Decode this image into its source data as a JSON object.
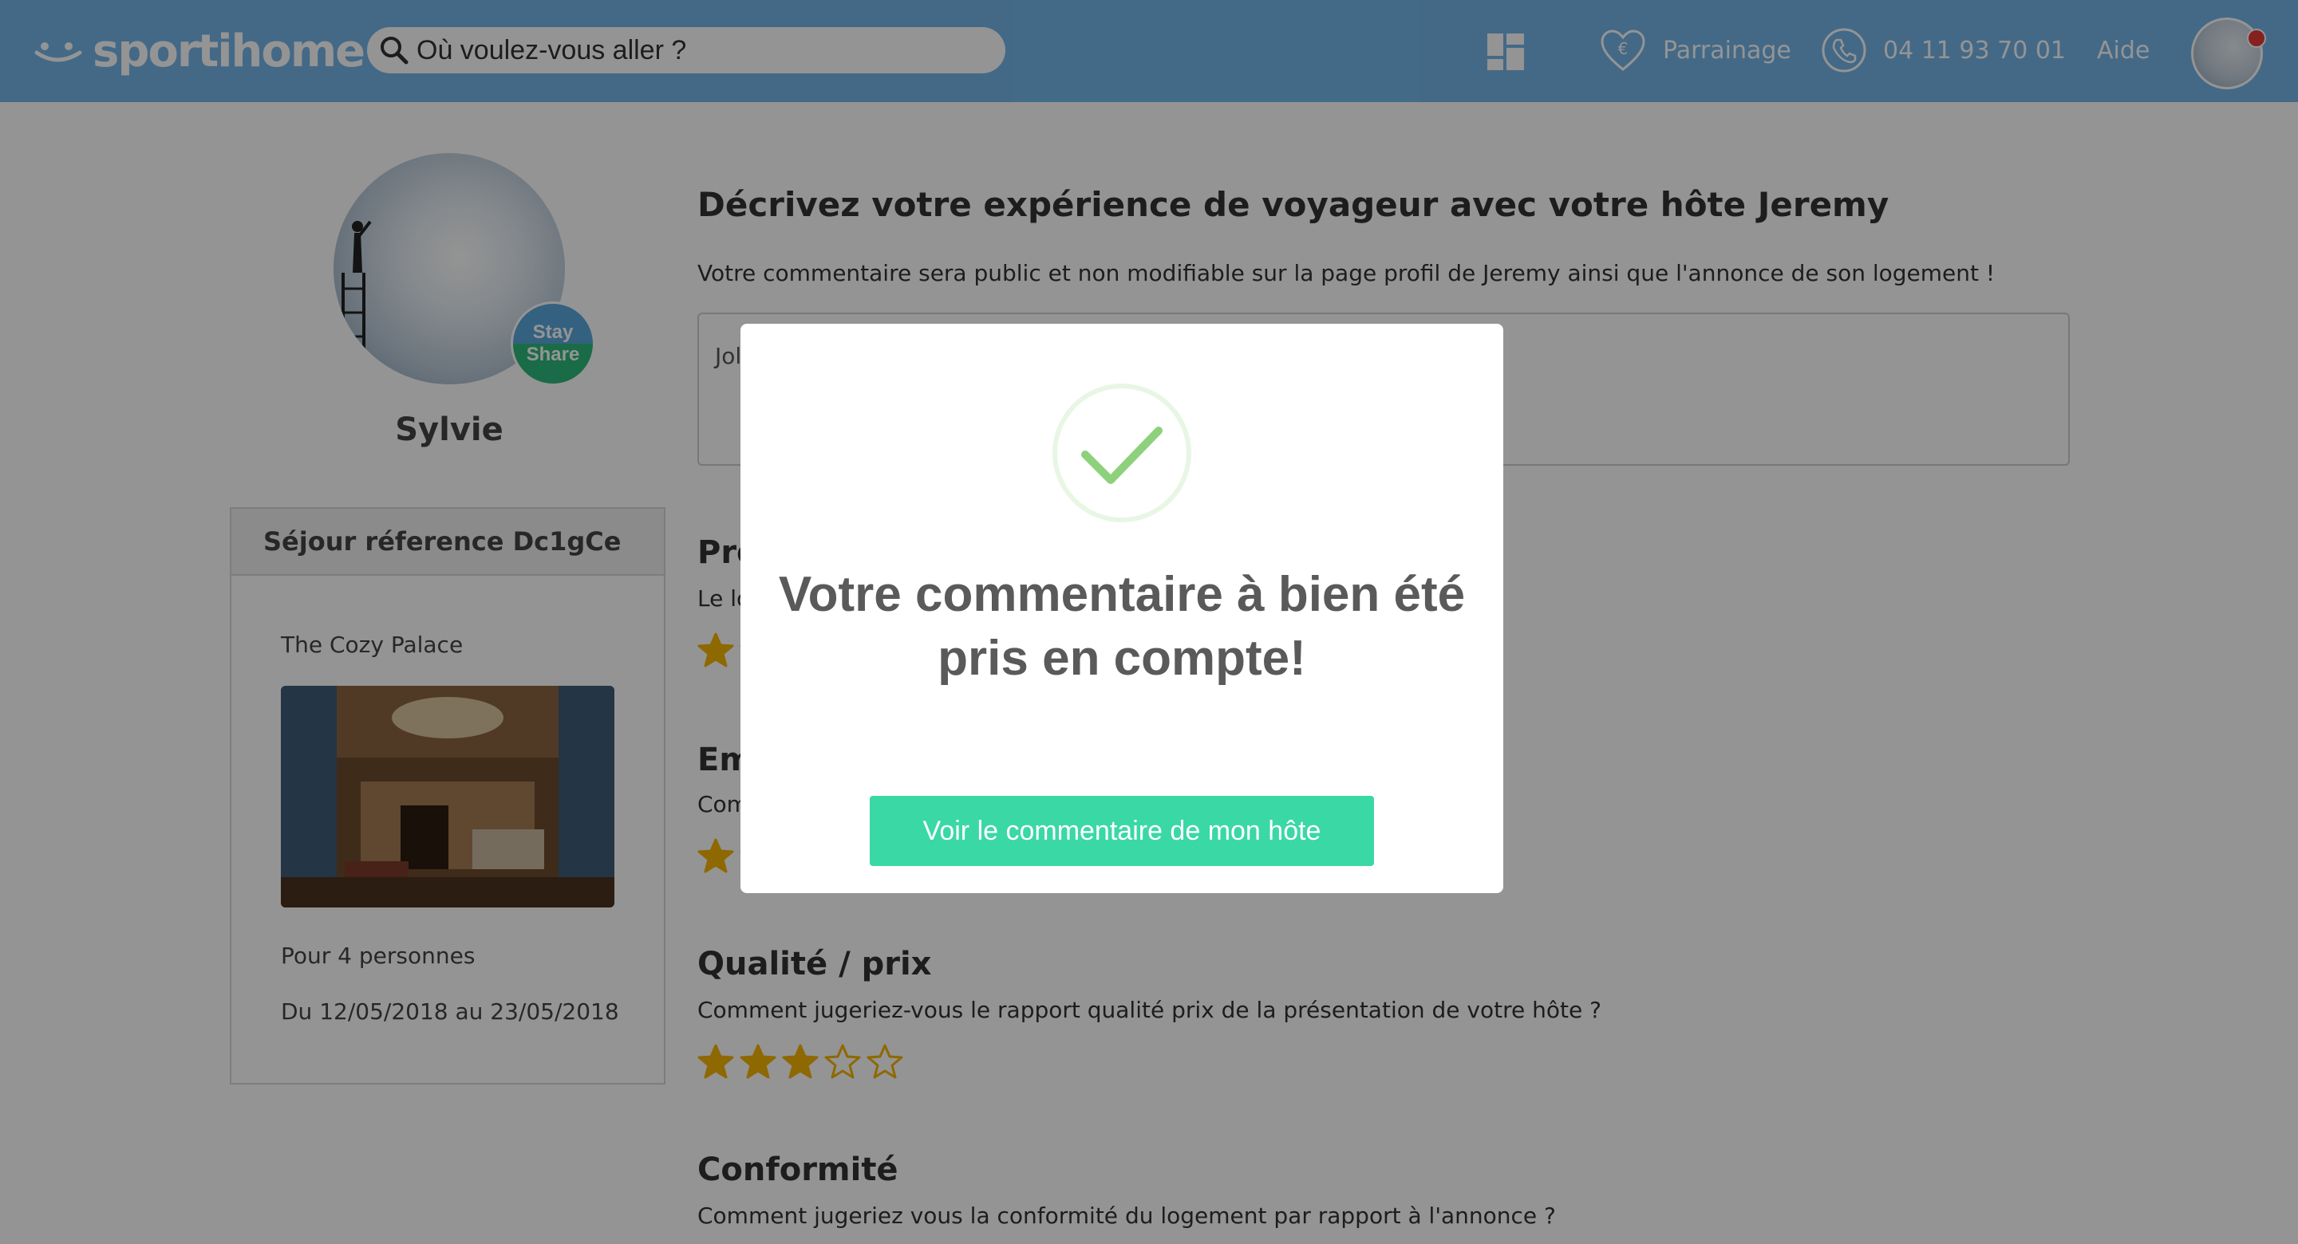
{
  "header": {
    "logo_text": "sportihome",
    "search_placeholder": "Où voulez-vous aller ?",
    "nav": {
      "referral_label": "Parrainage",
      "phone_label": "04 11 93 70 01",
      "help_label": "Aide"
    }
  },
  "profile": {
    "name": "Sylvie",
    "badge_top": "Stay",
    "badge_bottom": "Share"
  },
  "stay": {
    "reference_label": "Séjour réference Dc1gCe",
    "title": "The Cozy Palace",
    "people": "Pour 4 personnes",
    "dates": "Du 12/05/2018 au 23/05/2018"
  },
  "review": {
    "title": "Décrivez votre expérience de voyageur avec votre hôte Jeremy",
    "subtitle": "Votre commentaire sera public et non modifiable sur la page profil de Jeremy ainsi que l'annonce de son logement !",
    "comment_value": "Jol",
    "sections": [
      {
        "title": "Pro",
        "description": "Le lo",
        "rating": 1
      },
      {
        "title": "Em",
        "description": "Com",
        "rating": 1
      },
      {
        "title": "Qualité / prix",
        "description": "Comment jugeriez-vous le rapport qualité prix de la présentation de votre hôte ?",
        "rating": 3
      },
      {
        "title": "Conformité",
        "description": "Comment jugeriez vous la conformité du logement par rapport à l'annonce ?",
        "rating": 0
      }
    ]
  },
  "modal": {
    "message_line1": "Votre commentaire à bien été",
    "message_line2": "pris en compte!",
    "button_label": "Voir le commentaire de mon hôte"
  },
  "colors": {
    "header_bg": "#74b6e8",
    "star": "#f4b400",
    "check": "#8ed17c",
    "button": "#3ad8a4",
    "badge_blue": "#5aa8db",
    "badge_green": "#2db87a"
  }
}
